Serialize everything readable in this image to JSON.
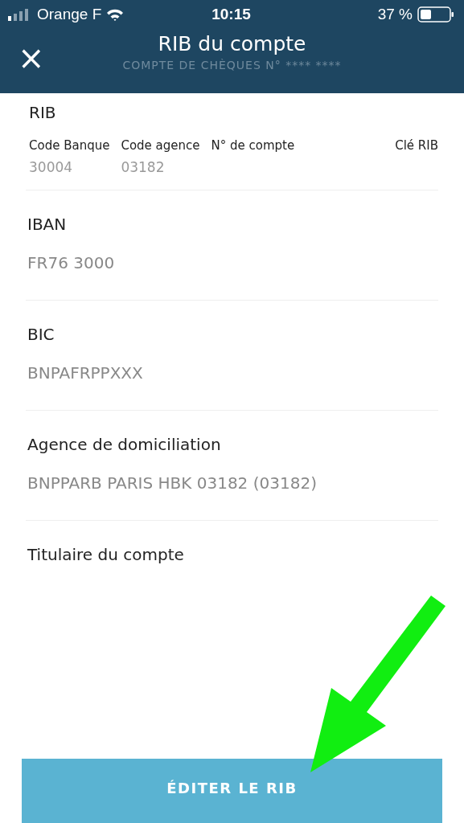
{
  "status_bar": {
    "carrier": "Orange F",
    "time": "10:15",
    "battery": "37 %"
  },
  "header": {
    "close_icon": "×",
    "title": "RIB du compte",
    "subtitle": "COMPTE DE CHÈQUES N° ****  ****"
  },
  "rib": {
    "title": "RIB",
    "columns": [
      {
        "label": "Code Banque",
        "value": "30004"
      },
      {
        "label": "Code agence",
        "value": "03182"
      },
      {
        "label": "N° de compte"
      },
      {
        "label": "Clé RIB"
      }
    ]
  },
  "fields": [
    {
      "label": "IBAN",
      "value": "FR76 3000"
    },
    {
      "label": "BIC",
      "value": "BNPAFRPPXXX"
    },
    {
      "label": "Agence de domiciliation",
      "value": "BNPPARB PARIS HBK 03182 (03182)"
    },
    {
      "label": "Titulaire du compte"
    }
  ],
  "button": "ÉDITER LE RIB"
}
